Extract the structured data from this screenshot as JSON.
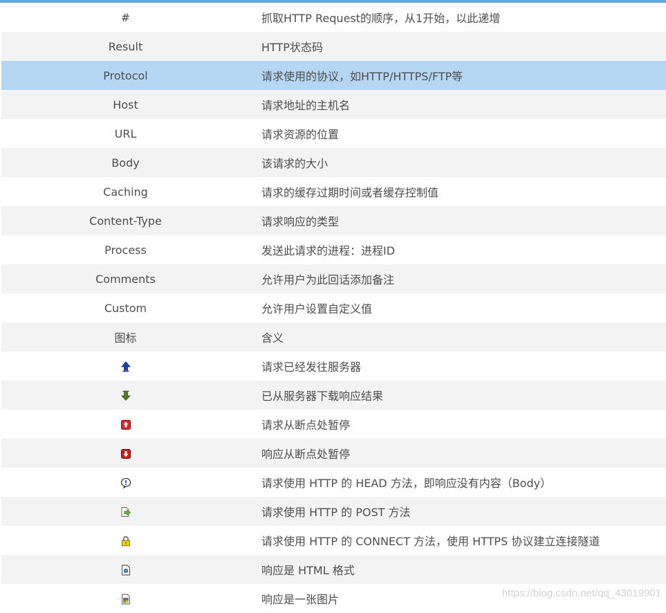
{
  "table": {
    "header": {
      "col1": "#",
      "col2": "抓取HTTP Request的顺序，从1开始，以此递增"
    },
    "columns": [
      {
        "name": "Result",
        "desc": "HTTP状态码"
      },
      {
        "name": "Protocol",
        "desc": "请求使用的协议，如HTTP/HTTPS/FTP等"
      },
      {
        "name": "Host",
        "desc": "请求地址的主机名"
      },
      {
        "name": "URL",
        "desc": "请求资源的位置"
      },
      {
        "name": "Body",
        "desc": "该请求的大小"
      },
      {
        "name": "Caching",
        "desc": "请求的缓存过期时间或者缓存控制值"
      },
      {
        "name": "Content-Type",
        "desc": "请求响应的类型"
      },
      {
        "name": "Process",
        "desc": "发送此请求的进程：进程ID"
      },
      {
        "name": "Comments",
        "desc": "允许用户为此回话添加备注"
      },
      {
        "name": "Custom",
        "desc": "允许用户设置自定义值"
      }
    ],
    "icon_header": {
      "col1": "图标",
      "col2": "含义"
    },
    "icons": [
      {
        "icon": "upload-arrow-icon",
        "desc": "请求已经发往服务器"
      },
      {
        "icon": "download-arrow-icon",
        "desc": "已从服务器下载响应结果"
      },
      {
        "icon": "request-breakpoint-icon",
        "desc": "请求从断点处暂停"
      },
      {
        "icon": "response-breakpoint-icon",
        "desc": "响应从断点处暂停"
      },
      {
        "icon": "head-method-icon",
        "desc": "请求使用 HTTP 的 HEAD 方法，即响应没有内容（Body）"
      },
      {
        "icon": "post-method-icon",
        "desc": "请求使用 HTTP 的 POST 方法"
      },
      {
        "icon": "lock-icon",
        "desc": "请求使用 HTTP 的 CONNECT 方法，使用 HTTPS 协议建立连接隧道"
      },
      {
        "icon": "html-document-icon",
        "desc": "响应是 HTML 格式"
      },
      {
        "icon": "image-file-icon",
        "desc": "响应是一张图片"
      }
    ],
    "selected_row": "Protocol"
  },
  "watermark": "https://blog.csdn.net/qq_43019901",
  "colors": {
    "top_bar": "#5fa8e6",
    "selected_row": "#b5d7f3",
    "stripe": "#f3f3f3",
    "text": "#4d4d4d"
  }
}
